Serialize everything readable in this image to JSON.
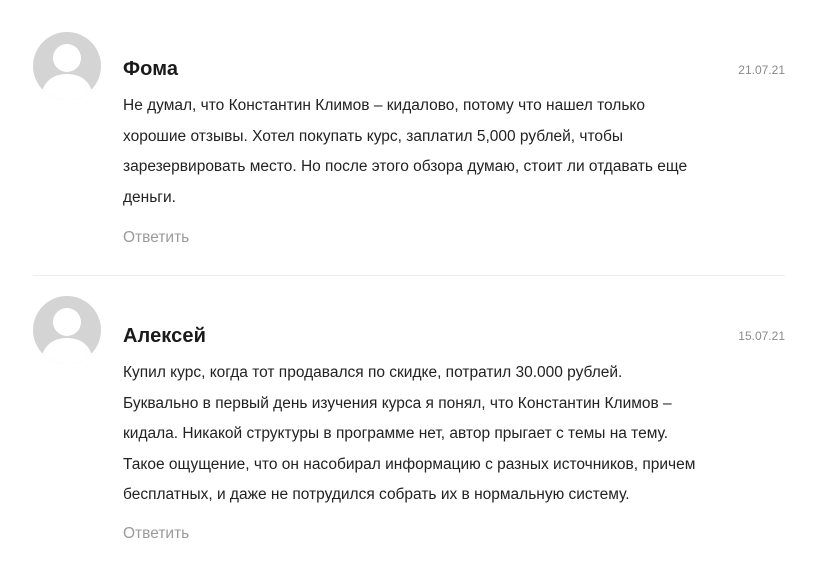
{
  "comments": [
    {
      "author": "Фома",
      "date": "21.07.21",
      "lines": [
        "Не думал, что Константин Климов – кидалово, потому что нашел только",
        "хорошие отзывы. Хотел покупать курс, заплатил 5,000 рублей, чтобы",
        "зарезервировать место. Но после этого обзора думаю, стоит ли отдавать еще",
        "деньги."
      ],
      "reply_label": "Ответить",
      "avatar_icon": "user-silhouette-icon"
    },
    {
      "author": "Алексей",
      "date": "15.07.21",
      "lines": [
        "Купил курс, когда тот продавался по скидке, потратил 30.000 рублей.",
        "Буквально в первый день изучения курса я понял, что Константин Климов –",
        "кидала. Никакой структуры в программе нет, автор прыгает с темы на тему.",
        "Такое ощущение, что он насобирал информацию с разных источников, причем",
        "бесплатных, и даже не потрудился собрать их в нормальную систему."
      ],
      "reply_label": "Ответить",
      "avatar_icon": "user-silhouette-icon"
    }
  ],
  "colors": {
    "avatar_bg": "#d4d4d4",
    "avatar_fg": "#ffffff",
    "text": "#222222",
    "muted": "#9a9a9a",
    "divider": "#ececec"
  }
}
